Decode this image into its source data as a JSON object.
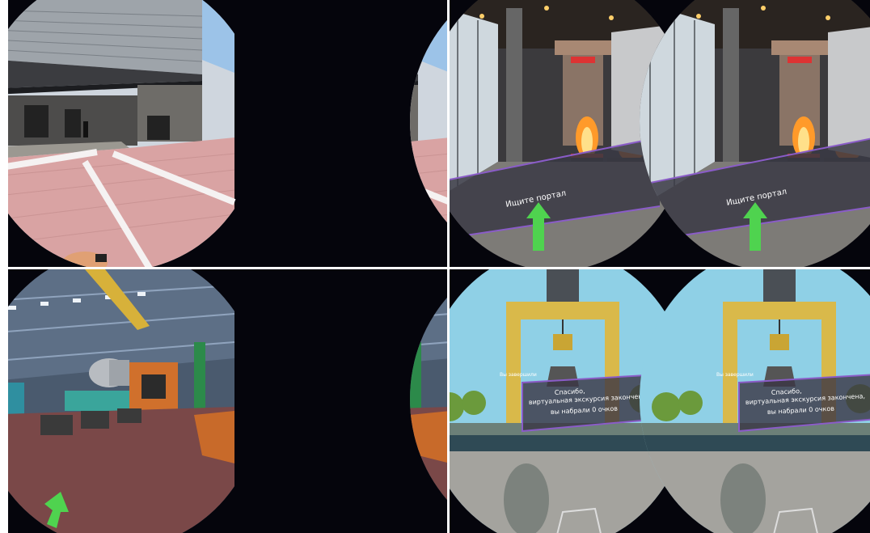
{
  "panels": [
    {
      "id": "vr-building-exterior",
      "hud_text": ""
    },
    {
      "id": "vr-steel-mill-furnace",
      "hud_text": "Ищите портал"
    },
    {
      "id": "vr-factory-hall-crane",
      "hud_text": ""
    },
    {
      "id": "vr-gantry-crane-result",
      "hud_label": "Вы завершили",
      "hud_text_lines": [
        "Спасибо,",
        "виртуальная экскурсия закончена,",
        "вы набрали 0 очков"
      ]
    }
  ],
  "colors": {
    "lens_bg": "#05050c",
    "hud_border": "#8a5cc8",
    "arrow_green": "#4fd34f"
  }
}
